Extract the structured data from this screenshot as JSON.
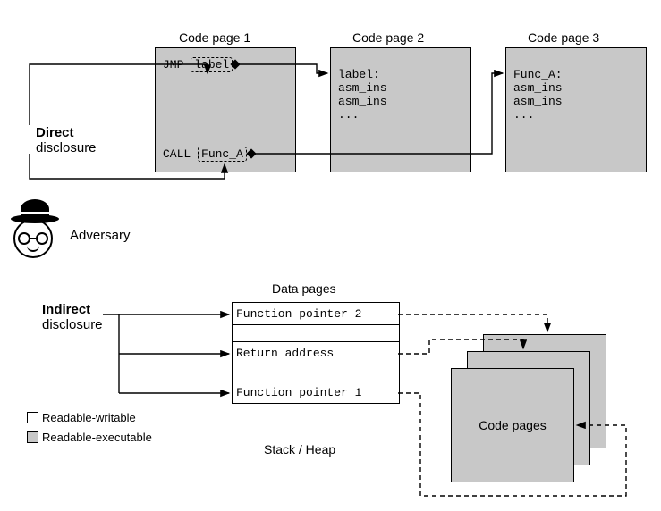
{
  "top": {
    "page1_title": "Code page 1",
    "page2_title": "Code page 2",
    "page3_title": "Code page 3",
    "p1_ins1_op": "JMP",
    "p1_ins1_arg": "label",
    "p1_ins2_op": "CALL",
    "p1_ins2_arg": "Func_A",
    "p2_l1": "label:",
    "p2_l2": "asm_ins",
    "p2_l3": "asm_ins",
    "p2_l4": "...",
    "p3_l1": "Func_A:",
    "p3_l2": "asm_ins",
    "p3_l3": "asm_ins",
    "p3_l4": "..."
  },
  "labels": {
    "direct_bold": "Direct",
    "direct_rest": "disclosure",
    "indirect_bold": "Indirect",
    "indirect_rest": "disclosure",
    "adversary": "Adversary",
    "data_pages": "Data pages",
    "stack_heap": "Stack / Heap",
    "code_pages_stack": "Code pages"
  },
  "data_rows": {
    "r1": "Function pointer 2",
    "r2": "Return address",
    "r3": "Function pointer 1"
  },
  "legend": {
    "rw": "Readable-writable",
    "rx": "Readable-executable"
  }
}
